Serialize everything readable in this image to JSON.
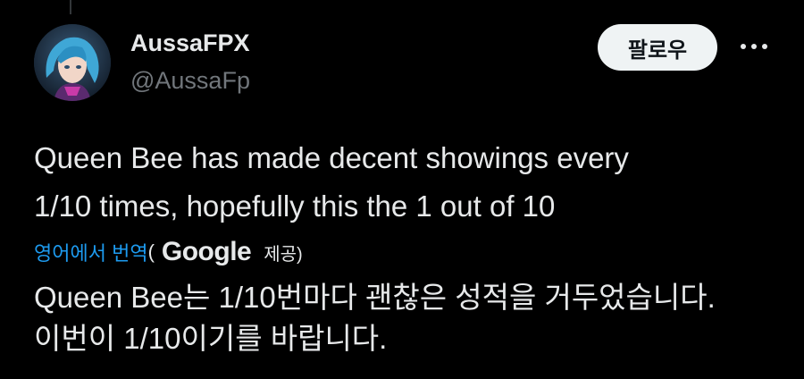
{
  "author": {
    "display_name": "AussaFPX",
    "handle": "@AussaFp",
    "avatar_icon": "anime-character-avatar"
  },
  "actions": {
    "follow_label": "팔로우",
    "more_icon": "more-horizontal-icon"
  },
  "tweet": {
    "lines": [
      "Queen Bee has made decent showings every",
      "1/10 times, hopefully this the 1 out of 10"
    ]
  },
  "translation": {
    "link_label": "영어에서 번역",
    "paren_open": "(",
    "provider": "Google",
    "provided_label": "제공)",
    "lines": [
      "Queen Bee는 1/10번마다 괜찮은 성적을 거두었습니다.",
      "이번이 1/10이기를 바랍니다."
    ]
  },
  "colors": {
    "background": "#000000",
    "text_primary": "#e7e9ea",
    "text_secondary": "#71767b",
    "link": "#1d9bf0",
    "follow_bg": "#eff3f4"
  }
}
